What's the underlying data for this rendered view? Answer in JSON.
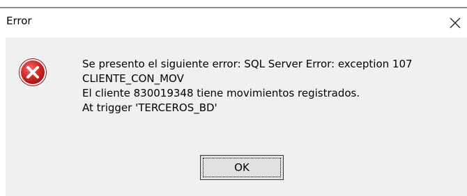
{
  "window": {
    "title": "Error",
    "close_icon": "close-icon"
  },
  "dialog": {
    "icon": "error-icon",
    "message_lines": [
      "Se presento el siguiente error: SQL Server Error: exception 107",
      "CLIENTE_CON_MOV",
      "El cliente 830019348 tiene movimientos registrados.",
      "At trigger 'TERCEROS_BD'"
    ],
    "ok_label": "OK"
  },
  "colors": {
    "dialog_background": "#f0f0f0",
    "error_red": "#d42a2a"
  }
}
